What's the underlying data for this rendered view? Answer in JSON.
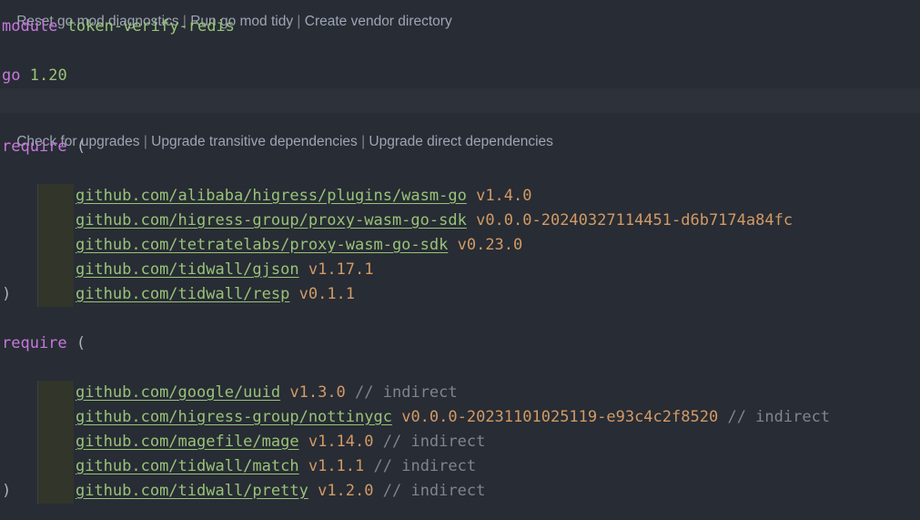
{
  "codelens_top": {
    "actions": [
      "Reset go.mod diagnostics",
      "Run go mod tidy",
      "Create vendor directory"
    ],
    "separator": " | "
  },
  "codelens_require": {
    "actions": [
      "Check for upgrades",
      "Upgrade transitive dependencies",
      "Upgrade direct dependencies"
    ],
    "separator": " | "
  },
  "module_line": {
    "keyword": "module",
    "name": "token-verify-redis"
  },
  "go_line": {
    "keyword": "go",
    "version": "1.20"
  },
  "require_block_1": {
    "keyword": "require",
    "open": "(",
    "close": ")",
    "deps": [
      {
        "path": "github.com/alibaba/higress/plugins/wasm-go",
        "version": "v1.4.0"
      },
      {
        "path": "github.com/higress-group/proxy-wasm-go-sdk",
        "version": "v0.0.0-20240327114451-d6b7174a84fc"
      },
      {
        "path": "github.com/tetratelabs/proxy-wasm-go-sdk",
        "version": "v0.23.0"
      },
      {
        "path": "github.com/tidwall/gjson",
        "version": "v1.17.1"
      },
      {
        "path": "github.com/tidwall/resp",
        "version": "v0.1.1"
      }
    ]
  },
  "require_block_2": {
    "keyword": "require",
    "open": "(",
    "close": ")",
    "comment": "// indirect",
    "deps": [
      {
        "path": "github.com/google/uuid",
        "version": "v1.3.0"
      },
      {
        "path": "github.com/higress-group/nottinygc",
        "version": "v0.0.0-20231101025119-e93c4c2f8520"
      },
      {
        "path": "github.com/magefile/mage",
        "version": "v1.14.0"
      },
      {
        "path": "github.com/tidwall/match",
        "version": "v1.1.1"
      },
      {
        "path": "github.com/tidwall/pretty",
        "version": "v1.2.0"
      }
    ]
  },
  "colors": {
    "background": "#282c34",
    "keyword": "#c678dd",
    "module_path": "#98c379",
    "version": "#d19a66",
    "comment": "#7f848e",
    "codelens": "#9da5b4"
  }
}
